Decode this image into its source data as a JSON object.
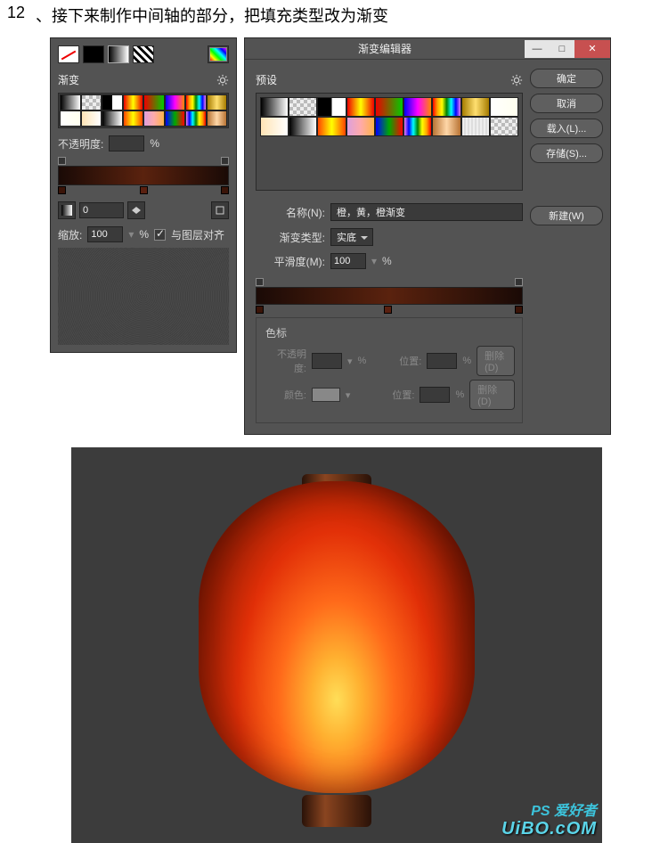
{
  "step": {
    "num": "12",
    "text": "、接下来制作中间轴的部分，把填充类型改为渐变"
  },
  "panel": {
    "section_label": "渐变",
    "opacity_label": "不透明度:",
    "opacity_val": "",
    "opacity_unit": "%",
    "angle_val": "0",
    "scale_label": "缩放:",
    "scale_val": "100",
    "scale_unit": "%",
    "align_label": "与图层对齐"
  },
  "editor": {
    "title": "渐变编辑器",
    "btns": {
      "ok": "确定",
      "cancel": "取消",
      "load": "载入(L)...",
      "save": "存储(S)...",
      "new": "新建(W)"
    },
    "presets_label": "预设",
    "name_label": "名称(N):",
    "name_val": "橙，黄，橙渐变",
    "type_label": "渐变类型:",
    "type_val": "实底",
    "smooth_label": "平滑度(M):",
    "smooth_val": "100",
    "smooth_unit": "%",
    "stops": {
      "title": "色标",
      "opacity_label": "不透明度:",
      "opacity_unit": "%",
      "pos_label": "位置:",
      "pos_unit": "%",
      "color_label": "颜色:",
      "delete_label": "删除(D)"
    }
  },
  "watermark": {
    "line1": "PS 爱好者",
    "line2": "UiBO.cOM"
  }
}
